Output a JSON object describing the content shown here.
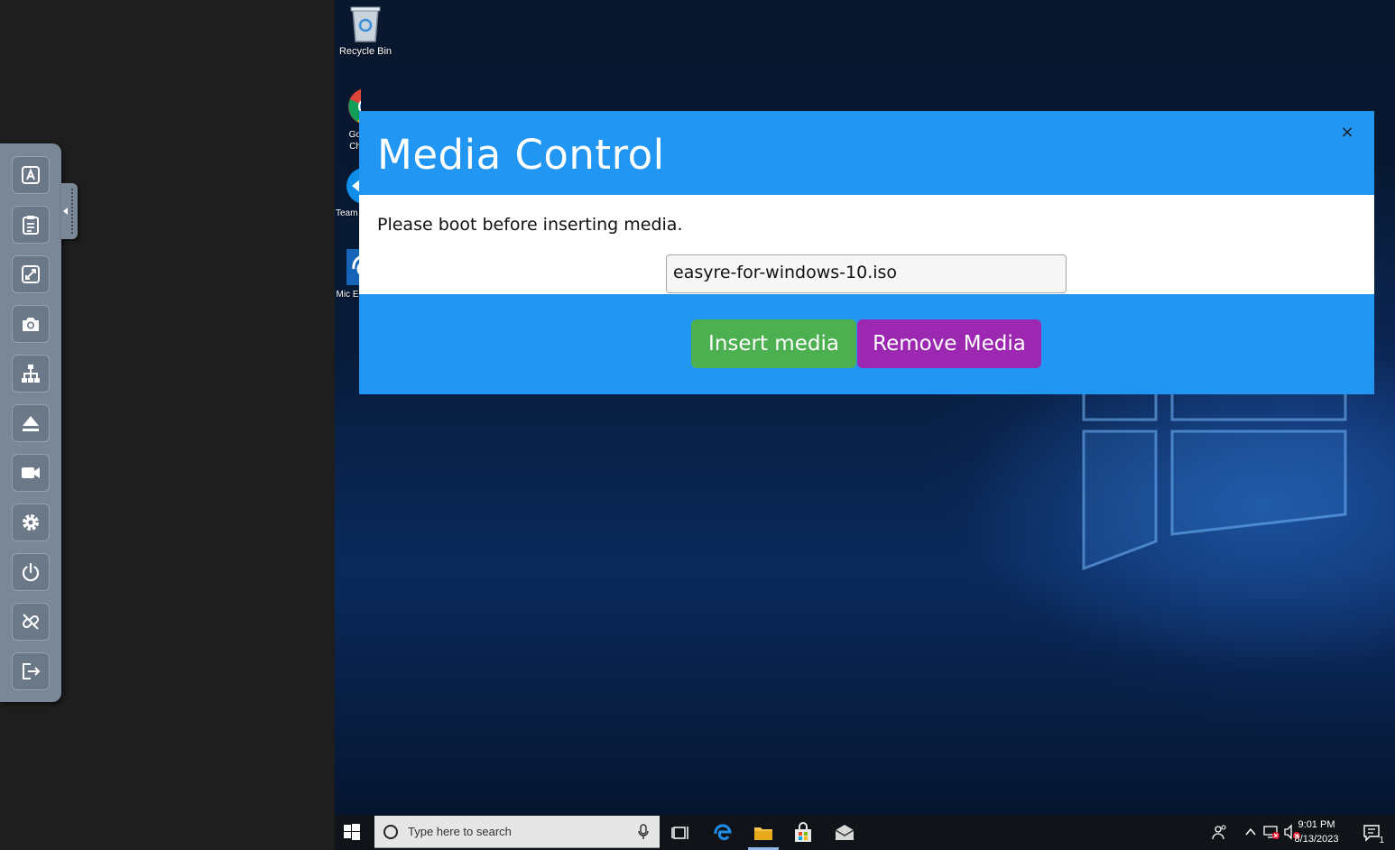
{
  "toolbar": {
    "buttons": [
      {
        "name": "keyboard-icon"
      },
      {
        "name": "clipboard-icon"
      },
      {
        "name": "fullscreen-icon"
      },
      {
        "name": "camera-icon"
      },
      {
        "name": "network-icon"
      },
      {
        "name": "eject-icon"
      },
      {
        "name": "video-icon"
      },
      {
        "name": "gear-icon"
      },
      {
        "name": "power-icon"
      },
      {
        "name": "disconnect-icon"
      },
      {
        "name": "logout-icon"
      }
    ]
  },
  "desktop": {
    "icons": [
      {
        "label": "Recycle Bin"
      },
      {
        "label": "Go Ch"
      },
      {
        "label": "Team"
      },
      {
        "label": "Mic E"
      }
    ]
  },
  "modal": {
    "title": "Media Control",
    "close_label": "×",
    "message": "Please boot before inserting media.",
    "media_select": {
      "selected": "easyre-for-windows-10.iso"
    },
    "insert_label": "Insert media",
    "remove_label": "Remove Media",
    "colors": {
      "header": "#2196f3",
      "insert": "#4caf50",
      "remove": "#9c27b0"
    }
  },
  "taskbar": {
    "search_placeholder": "Type here to search",
    "time": "9:01 PM",
    "date": "8/13/2023",
    "notification_count": "1"
  }
}
